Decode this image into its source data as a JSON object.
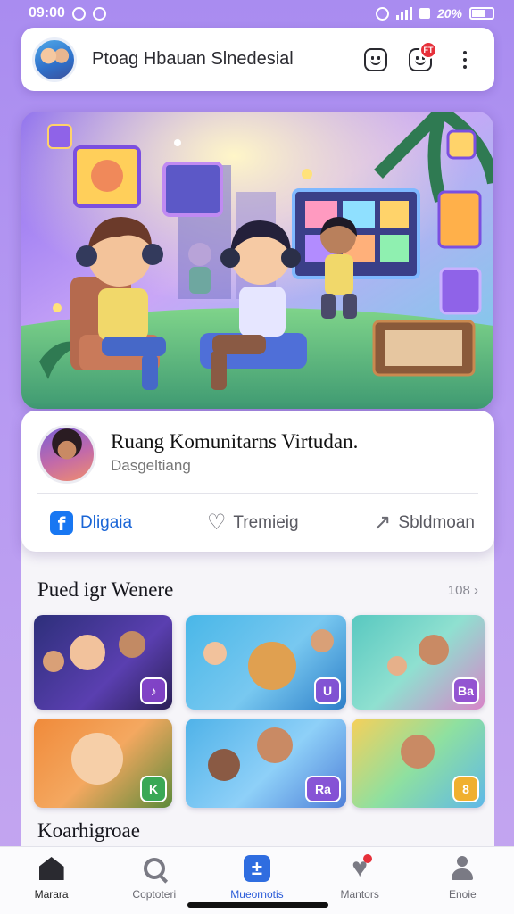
{
  "status_bar": {
    "time": "09:00",
    "battery_text": "20%"
  },
  "header": {
    "title": "Ptoag Hbauan Slnedesial",
    "notification_badge": "FT"
  },
  "community": {
    "name": "Ruang Komunitarns Virtudan.",
    "subtitle": "Dasgeltiang",
    "actions": {
      "share_fb": "Dligaia",
      "like": "Tremieig",
      "share": "Sbldmoan"
    }
  },
  "section": {
    "title": "Pued igr Wenere",
    "see_all": "108 ›",
    "second_title": "Koarhigroae"
  },
  "tiles": [
    {
      "badge": "♪"
    },
    {
      "badge": "U"
    },
    {
      "badge": "Ba"
    },
    {
      "badge": "K"
    },
    {
      "badge": "Ra"
    },
    {
      "badge": "8"
    }
  ],
  "nav": {
    "items": [
      {
        "label": "Marara"
      },
      {
        "label": "Coptoteri"
      },
      {
        "label": "Mueornotis"
      },
      {
        "label": "Mantors"
      },
      {
        "label": "Enoie"
      }
    ]
  }
}
